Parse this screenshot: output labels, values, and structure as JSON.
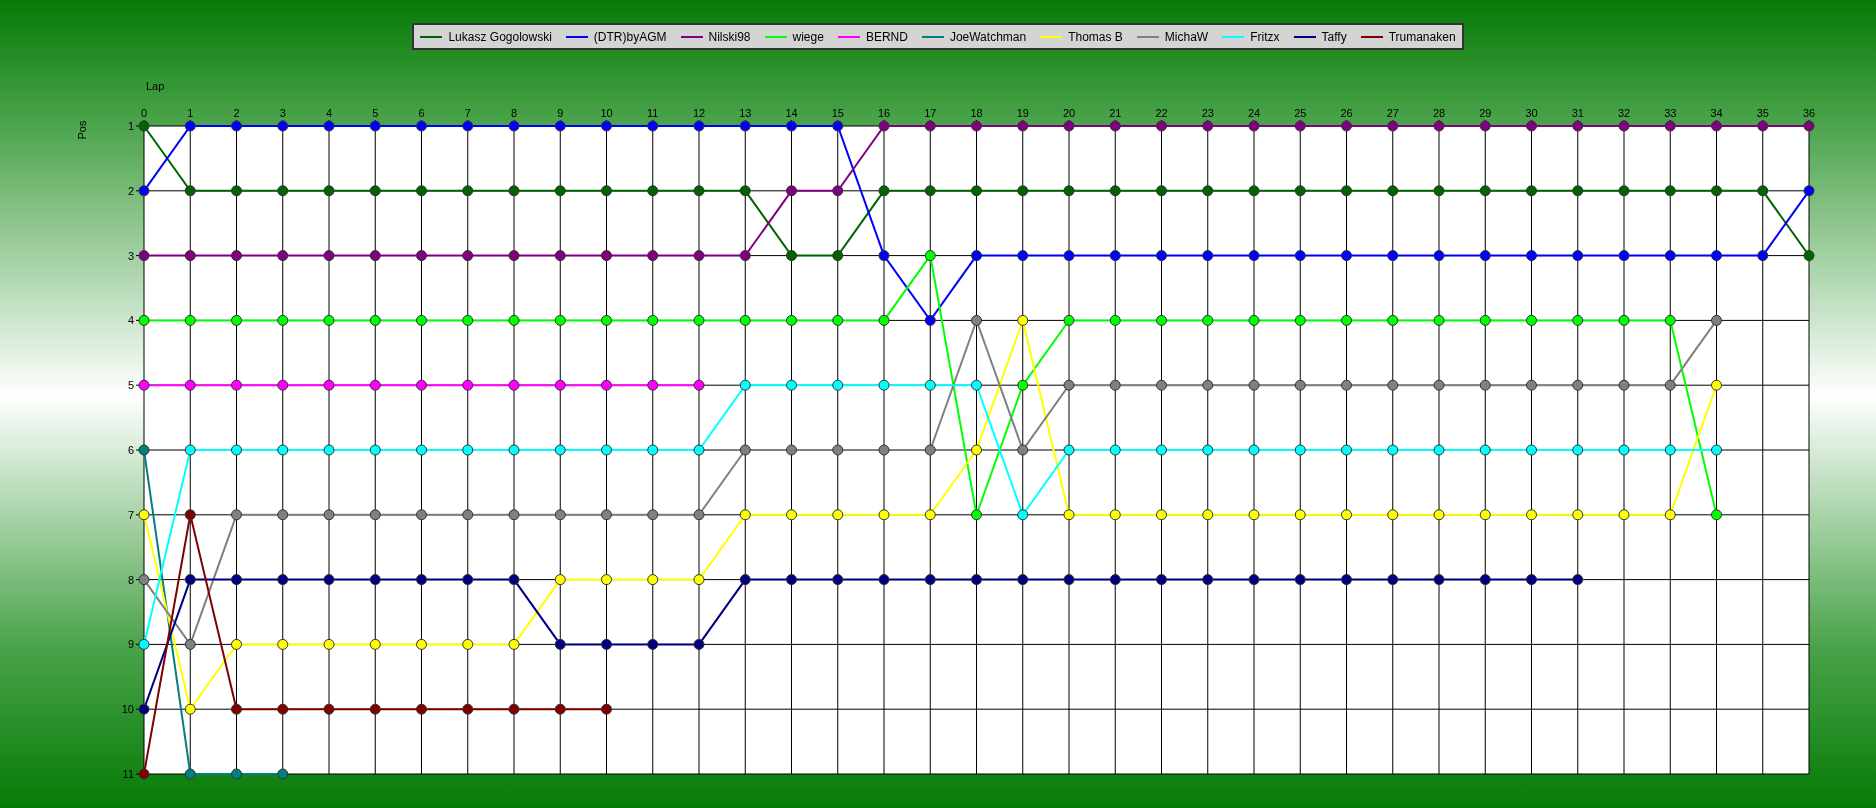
{
  "chart": {
    "chart_data": {
      "type": "line",
      "xlabel": "Lap",
      "ylabel": "Pos",
      "x": [
        0,
        1,
        2,
        3,
        4,
        5,
        6,
        7,
        8,
        9,
        10,
        11,
        12,
        13,
        14,
        15,
        16,
        17,
        18,
        19,
        20,
        21,
        22,
        23,
        24,
        25,
        26,
        27,
        28,
        29,
        30,
        31,
        32,
        33,
        34,
        35,
        36
      ],
      "xticks": [
        0,
        1,
        2,
        3,
        4,
        5,
        6,
        7,
        8,
        9,
        10,
        11,
        12,
        13,
        14,
        15,
        16,
        17,
        18,
        19,
        20,
        21,
        22,
        23,
        24,
        25,
        26,
        27,
        28,
        29,
        30,
        31,
        32,
        33,
        34,
        35,
        36
      ],
      "xlim": [
        0,
        36
      ],
      "grid": true,
      "yticks": [
        1,
        2,
        3,
        4,
        5,
        6,
        7,
        8,
        9,
        10,
        11
      ],
      "ylim": [
        11,
        1
      ],
      "series": [
        {
          "name": "Lukasz Gogolowski",
          "color": "#006400",
          "marker": "circle",
          "values": [
            1,
            2,
            2,
            2,
            2,
            2,
            2,
            2,
            2,
            2,
            2,
            2,
            2,
            2,
            3,
            3,
            2,
            2,
            2,
            2,
            2,
            2,
            2,
            2,
            2,
            2,
            2,
            2,
            2,
            2,
            2,
            2,
            2,
            2,
            2,
            2,
            3
          ]
        },
        {
          "name": "(DTR)byAGM",
          "color": "#0000ff",
          "marker": "circle",
          "values": [
            2,
            1,
            1,
            1,
            1,
            1,
            1,
            1,
            1,
            1,
            1,
            1,
            1,
            1,
            1,
            1,
            3,
            4,
            3,
            3,
            3,
            3,
            3,
            3,
            3,
            3,
            3,
            3,
            3,
            3,
            3,
            3,
            3,
            3,
            3,
            3,
            2
          ]
        },
        {
          "name": "Nilski98",
          "color": "#800080",
          "marker": "circle",
          "values": [
            3,
            3,
            3,
            3,
            3,
            3,
            3,
            3,
            3,
            3,
            3,
            3,
            3,
            3,
            2,
            2,
            1,
            1,
            1,
            1,
            1,
            1,
            1,
            1,
            1,
            1,
            1,
            1,
            1,
            1,
            1,
            1,
            1,
            1,
            1,
            1,
            1
          ]
        },
        {
          "name": "wiege",
          "color": "#00ff00",
          "marker": "circle",
          "values": [
            4,
            4,
            4,
            4,
            4,
            4,
            4,
            4,
            4,
            4,
            4,
            4,
            4,
            4,
            4,
            4,
            4,
            3,
            7,
            5,
            4,
            4,
            4,
            4,
            4,
            4,
            4,
            4,
            4,
            4,
            4,
            4,
            4,
            4,
            7,
            null,
            null
          ]
        },
        {
          "name": "BERND",
          "color": "#ff00ff",
          "marker": "circle",
          "values": [
            5,
            5,
            5,
            5,
            5,
            5,
            5,
            5,
            5,
            5,
            5,
            5,
            5,
            null,
            null,
            null,
            null,
            null,
            null,
            null,
            null,
            null,
            null,
            null,
            null,
            null,
            null,
            null,
            null,
            null,
            null,
            null,
            null,
            null,
            null,
            null,
            null
          ]
        },
        {
          "name": "JoeWatchman",
          "color": "#008080",
          "marker": "circle",
          "values": [
            6,
            11,
            11,
            11,
            null,
            null,
            null,
            null,
            null,
            null,
            null,
            null,
            null,
            null,
            null,
            null,
            null,
            null,
            null,
            null,
            null,
            null,
            null,
            null,
            null,
            null,
            null,
            null,
            null,
            null,
            null,
            null,
            null,
            null,
            null,
            null,
            null
          ]
        },
        {
          "name": "Thomas B",
          "color": "#ffff00",
          "marker": "circle",
          "values": [
            7,
            10,
            9,
            9,
            9,
            9,
            9,
            9,
            9,
            8,
            8,
            8,
            8,
            7,
            7,
            7,
            7,
            7,
            6,
            4,
            7,
            7,
            7,
            7,
            7,
            7,
            7,
            7,
            7,
            7,
            7,
            7,
            7,
            7,
            5,
            null,
            null
          ]
        },
        {
          "name": "MichaW",
          "color": "#808080",
          "marker": "circle",
          "values": [
            8,
            9,
            7,
            7,
            7,
            7,
            7,
            7,
            7,
            7,
            7,
            7,
            7,
            6,
            6,
            6,
            6,
            6,
            4,
            6,
            5,
            5,
            5,
            5,
            5,
            5,
            5,
            5,
            5,
            5,
            5,
            5,
            5,
            5,
            4,
            null,
            null
          ]
        },
        {
          "name": "Fritzx",
          "color": "#00ffff",
          "marker": "circle",
          "values": [
            9,
            6,
            6,
            6,
            6,
            6,
            6,
            6,
            6,
            6,
            6,
            6,
            6,
            5,
            5,
            5,
            5,
            5,
            5,
            7,
            6,
            6,
            6,
            6,
            6,
            6,
            6,
            6,
            6,
            6,
            6,
            6,
            6,
            6,
            6,
            null,
            null
          ]
        },
        {
          "name": "Taffy",
          "color": "#000080",
          "marker": "circle",
          "values": [
            10,
            8,
            8,
            8,
            8,
            8,
            8,
            8,
            8,
            9,
            9,
            9,
            9,
            8,
            8,
            8,
            8,
            8,
            8,
            8,
            8,
            8,
            8,
            8,
            8,
            8,
            8,
            8,
            8,
            8,
            8,
            8,
            null,
            null,
            null,
            null,
            null
          ]
        },
        {
          "name": "Trumanaken",
          "color": "#800000",
          "marker": "circle",
          "values": [
            11,
            7,
            10,
            10,
            10,
            10,
            10,
            10,
            10,
            10,
            10,
            null,
            null,
            null,
            null,
            null,
            null,
            null,
            null,
            null,
            null,
            null,
            null,
            null,
            null,
            null,
            null,
            null,
            null,
            null,
            null,
            null,
            null,
            null,
            null,
            null,
            null
          ]
        }
      ]
    }
  }
}
